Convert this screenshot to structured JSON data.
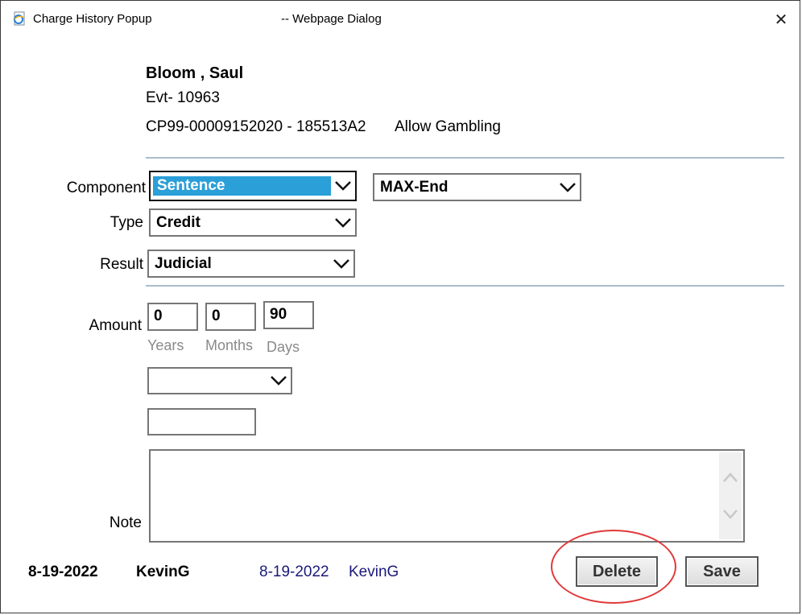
{
  "window": {
    "title": "Charge History Popup",
    "subtitle": "-- Webpage Dialog",
    "close_glyph": "✕"
  },
  "person": {
    "name": "Bloom , Saul",
    "event": "Evt- 10963",
    "charge_code": "CP99-00009152020 - 185513A2",
    "charge_desc": "Allow Gambling"
  },
  "form": {
    "component_label": "Component",
    "component_value": "Sentence",
    "component_sub_value": "MAX-End",
    "type_label": "Type",
    "type_value": "Credit",
    "result_label": "Result",
    "result_value": "Judicial",
    "amount_label": "Amount",
    "years_value": "0",
    "years_label": "Years",
    "months_value": "0",
    "months_label": "Months",
    "days_value": "90",
    "days_label": "Days",
    "extra_select_value": "",
    "extra_input_value": "",
    "note_label": "Note",
    "note_value": ""
  },
  "footer": {
    "created_date": "8-19-2022",
    "created_user": "KevinG",
    "modified_date": "8-19-2022",
    "modified_user": "KevinG",
    "delete_label": "Delete",
    "save_label": "Save"
  },
  "colors": {
    "highlight": "#2a9fd8",
    "annotation_circle": "#e0393a",
    "separator": "#a9bccd",
    "link_text": "#1a1a7a"
  },
  "icons": {
    "app": "ie-page-icon",
    "close": "close-icon",
    "dropdown": "chevron-down-icon",
    "scroll_up": "chevron-up-icon",
    "scroll_down": "chevron-down-icon"
  }
}
